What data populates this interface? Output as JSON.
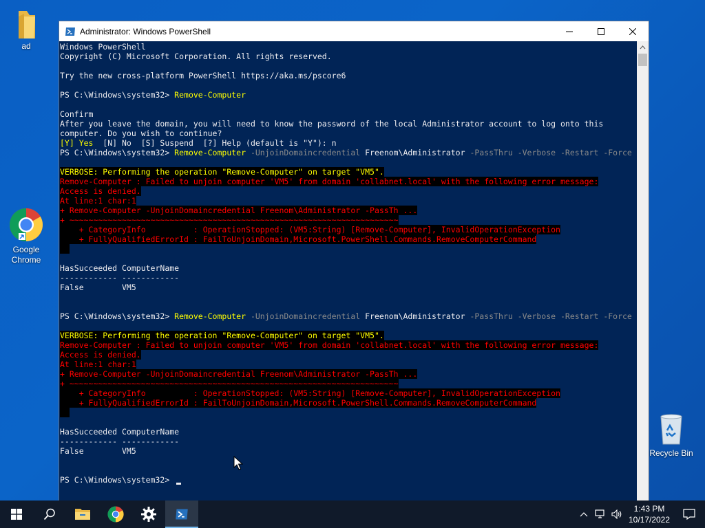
{
  "desktop": {
    "icons": [
      {
        "label": "ad"
      },
      {
        "label": "Google Chrome"
      },
      {
        "label": "Recycle Bin"
      }
    ]
  },
  "window": {
    "title": "Administrator: Windows PowerShell"
  },
  "console": {
    "header": [
      "Windows PowerShell",
      "Copyright (C) Microsoft Corporation. All rights reserved.",
      "Try the new cross-platform PowerShell https://aka.ms/pscore6"
    ],
    "prompt": "PS C:\\Windows\\system32> ",
    "cmd1": "Remove-Computer",
    "confirm": [
      "Confirm",
      "After you leave the domain, you will need to know the password of the local Administrator account to log onto this",
      "computer. Do you wish to continue?"
    ],
    "choice_yes": "[Y] Yes",
    "choice_rest": "  [N] No  [S] Suspend  [?] Help (default is \"Y\"): n",
    "cmd2": {
      "name": "Remove-Computer",
      "p1": " -UnjoinDomaincredential ",
      "v1": "Freenom\\Administrator",
      "p2": " -PassThru -Verbose -Restart -Force"
    },
    "verbose": "VERBOSE: Performing the operation \"Remove-Computer\" on target \"VM5\".",
    "errors": [
      "Remove-Computer : Failed to unjoin computer 'VM5' from domain 'collabnet.local' with the following error message:",
      "Access is denied.",
      "At line:1 char:1",
      "+ Remove-Computer -UnjoinDomaincredential Freenom\\Administrator -PassTh ...",
      "+ ~~~~~~~~~~~~~~~~~~~~~~~~~~~~~~~~~~~~~~~~~~~~~~~~~~~~~~~~~~~~~~~~~~~~~",
      "    + CategoryInfo          : OperationStopped: (VM5:String) [Remove-Computer], InvalidOperationException",
      "    + FullyQualifiedErrorId : FailToUnjoinDomain,Microsoft.PowerShell.Commands.RemoveComputerCommand"
    ],
    "table_header": "HasSucceeded ComputerName",
    "table_divider": "------------ ------------",
    "table_row": "False        VM5"
  },
  "taskbar": {
    "time": "1:43 PM",
    "date": "10/17/2022"
  }
}
